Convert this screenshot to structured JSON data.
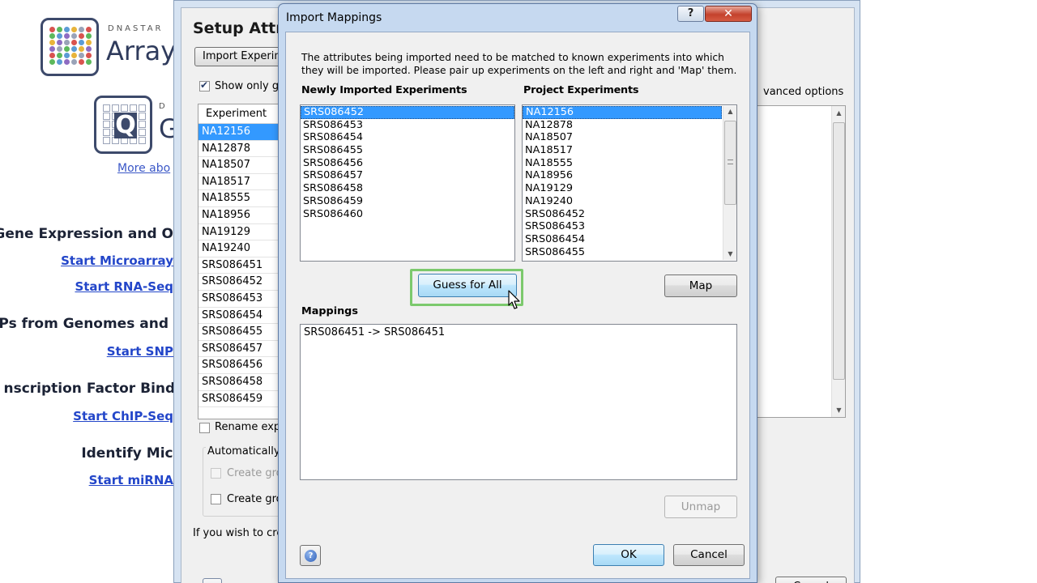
{
  "launcher": {
    "brand1_small": "DNASTAR",
    "brand1_big": "Array",
    "brand2_small": "D",
    "brand2_big": "G",
    "more_about": "More abo",
    "sections": [
      {
        "title": "Gene Expression and O",
        "links": [
          "Start Microarray",
          "Start RNA-Seq"
        ]
      },
      {
        "title": "NPs from Genomes and",
        "links": [
          "Start SNP"
        ]
      },
      {
        "title": "nscription Factor Bindi",
        "links": [
          "Start ChIP-Seq"
        ]
      },
      {
        "title": "Identify Micr",
        "links": [
          "Start miRNA"
        ]
      }
    ]
  },
  "setup": {
    "title": "Setup Attri",
    "import_button": "Import Experim",
    "show_only": "Show only gr",
    "advanced_options": "vanced options",
    "table_header": "Experiment",
    "experiments": [
      "NA12156",
      "NA12878",
      "NA18507",
      "NA18517",
      "NA18555",
      "NA18956",
      "NA19129",
      "NA19240",
      "SRS086451",
      "SRS086452",
      "SRS086453",
      "SRS086454",
      "SRS086455",
      "SRS086457",
      "SRS086456",
      "SRS086458",
      "SRS086459"
    ],
    "selected_experiment": "NA12156",
    "rename_label": "Rename expe",
    "auto_group_label": "Automatically g",
    "create_group_1": "Create grou",
    "create_group_2": "Create grou",
    "footer_text": "If you wish to crea",
    "cancel": "Cancel"
  },
  "dialog": {
    "title": "Import Mappings",
    "help_button": "?",
    "close_button": "✕",
    "description": "The attributes being imported need to be matched to known experiments into which they will be imported. Please pair up experiments on the left and right and 'Map' them.",
    "newly_imported_label": "Newly Imported Experiments",
    "project_experiments_label": "Project Experiments",
    "newly_imported": [
      "SRS086452",
      "SRS086453",
      "SRS086454",
      "SRS086455",
      "SRS086456",
      "SRS086457",
      "SRS086458",
      "SRS086459",
      "SRS086460"
    ],
    "newly_selected": "SRS086452",
    "project_experiments": [
      "NA12156",
      "NA12878",
      "NA18507",
      "NA18517",
      "NA18555",
      "NA18956",
      "NA19129",
      "NA19240",
      "SRS086452",
      "SRS086453",
      "SRS086454",
      "SRS086455"
    ],
    "project_selected": "NA12156",
    "guess_for_all": "Guess for All",
    "map": "Map",
    "mappings_label": "Mappings",
    "mappings": [
      "SRS086451 -> SRS086451"
    ],
    "unmap": "Unmap",
    "ok": "OK",
    "cancel": "Cancel"
  },
  "colors": {
    "selection": "#3399ff",
    "link": "#2346c9",
    "highlight_frame": "#7cc96d",
    "close_button": "#c4412c"
  }
}
